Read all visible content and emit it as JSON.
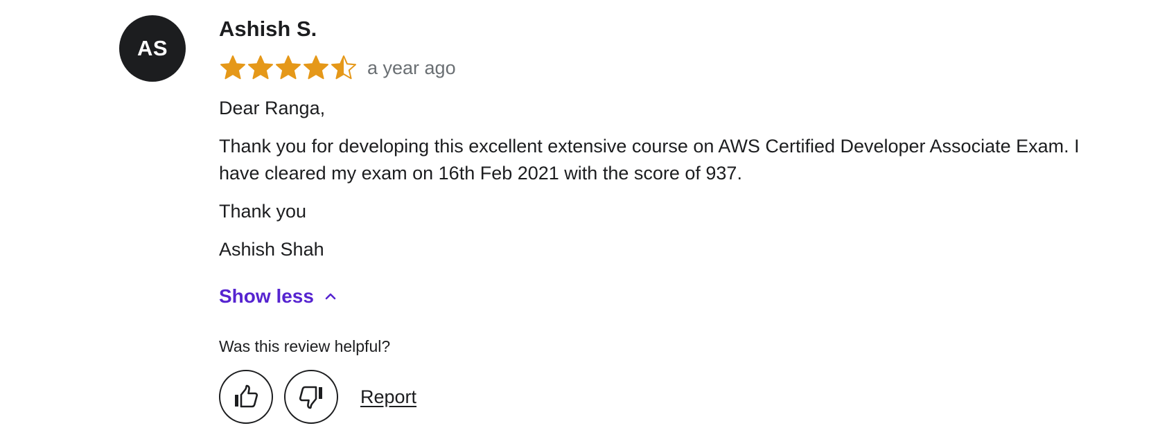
{
  "review": {
    "avatar_initials": "AS",
    "reviewer_name": "Ashish S.",
    "rating": 4.5,
    "rating_max": 5,
    "star_color": "#e59819",
    "time_ago": "a year ago",
    "paragraphs": [
      "Dear Ranga,",
      "Thank you for developing this excellent extensive course on AWS Certified Developer Associate Exam. I have cleared my exam on 16th Feb 2021 with the score of 937.",
      "Thank you",
      "Ashish Shah"
    ],
    "show_less_label": "Show less",
    "helpful_question": "Was this review helpful?",
    "report_label": "Report"
  },
  "colors": {
    "link_purple": "#5624d0",
    "text_dark": "#1c1d1f",
    "text_muted": "#6a6f73"
  },
  "icons": {
    "helpful": "thumbs-up-icon",
    "not_helpful": "thumbs-down-icon",
    "collapse": "chevron-up-icon"
  }
}
